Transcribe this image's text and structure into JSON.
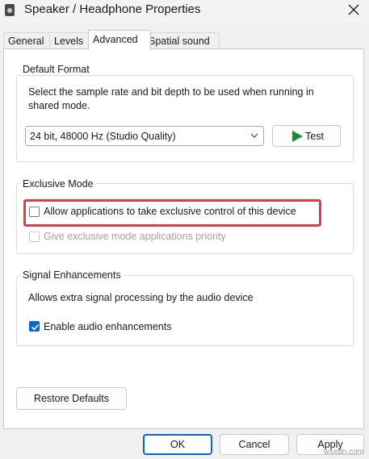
{
  "window": {
    "title": "Speaker / Headphone Properties"
  },
  "tabs": [
    {
      "label": "General"
    },
    {
      "label": "Levels"
    },
    {
      "label": "Advanced",
      "active": true
    },
    {
      "label": "Spatial sound"
    }
  ],
  "default_format": {
    "group_label": "Default Format",
    "description": "Select the sample rate and bit depth to be used when running in shared mode.",
    "selected_format": "24 bit, 48000 Hz (Studio Quality)",
    "test_label": "Test"
  },
  "exclusive_mode": {
    "group_label": "Exclusive Mode",
    "allow_exclusive": {
      "label": "Allow applications to take exclusive control of this device",
      "checked": false
    },
    "give_priority": {
      "label": "Give exclusive mode applications priority",
      "checked": false,
      "disabled": true
    }
  },
  "signal_enhancements": {
    "group_label": "Signal Enhancements",
    "description": "Allows extra signal processing by the audio device",
    "enable_enhancements": {
      "label": "Enable audio enhancements",
      "checked": true
    }
  },
  "restore_defaults_label": "Restore Defaults",
  "footer": {
    "ok_label": "OK",
    "cancel_label": "Cancel",
    "apply_label": "Apply"
  },
  "watermark": "wsxdn.com",
  "colors": {
    "accent": "#0a63c9",
    "highlight": "#d9404a",
    "play": "#1f8a3a"
  },
  "icons": {
    "close": "close-icon",
    "dropdown": "chevron-down-icon",
    "play": "play-icon",
    "app": "speaker-icon"
  }
}
